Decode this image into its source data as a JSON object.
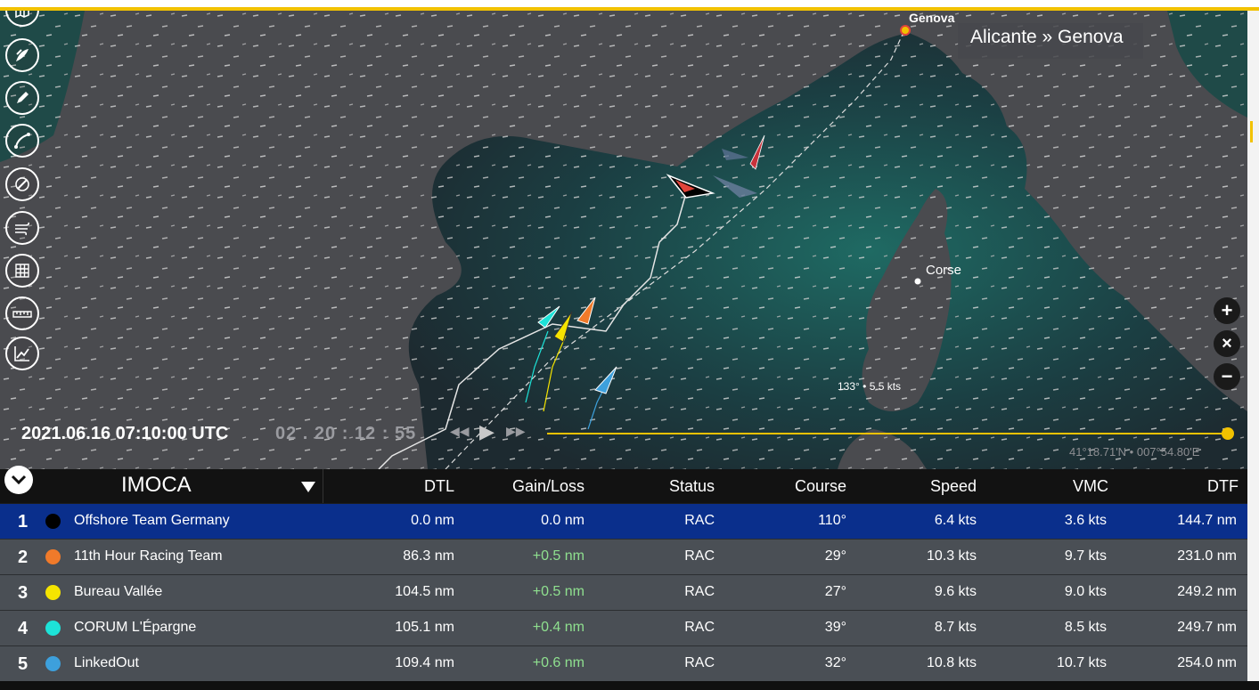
{
  "race": {
    "title": "Alicante » Genova"
  },
  "places": {
    "genova": "Genova",
    "corse": "Corse"
  },
  "wind_readout": "133° • 5.5 kts",
  "playback": {
    "datetime": "2021.06.16 07:10:00 UTC",
    "elapsed": "02 . 20 : 12 : 55",
    "rewind": "◀◀",
    "play": "▶",
    "forward": "▶▶",
    "progress_percent": 100
  },
  "coords": "41°18.71'N • 007°54.80'E",
  "zoom": {
    "in": "+",
    "reset": "×",
    "out": "−"
  },
  "tools": [
    "map-layers-icon",
    "sail-icon",
    "pencil-icon",
    "route-icon",
    "compass-icon",
    "wind-icon",
    "grid-icon",
    "ruler-icon",
    "chart-icon"
  ],
  "table": {
    "class_name": "IMOCA",
    "columns": {
      "dtl": "DTL",
      "gain": "Gain/Loss",
      "status": "Status",
      "course": "Course",
      "speed": "Speed",
      "vmc": "VMC",
      "dtf": "DTF"
    },
    "rows": [
      {
        "rank": "1",
        "color": "#000000",
        "name": "Offshore Team Germany",
        "dtl": "0.0 nm",
        "gain": "0.0 nm",
        "status": "RAC",
        "course": "110°",
        "speed": "6.4 kts",
        "vmc": "3.6 kts",
        "dtf": "144.7 nm"
      },
      {
        "rank": "2",
        "color": "#f07a2a",
        "name": "11th Hour Racing Team",
        "dtl": "86.3 nm",
        "gain": "+0.5 nm",
        "status": "RAC",
        "course": "29°",
        "speed": "10.3 kts",
        "vmc": "9.7 kts",
        "dtf": "231.0 nm"
      },
      {
        "rank": "3",
        "color": "#f5e400",
        "name": "Bureau Vallée",
        "dtl": "104.5 nm",
        "gain": "+0.5 nm",
        "status": "RAC",
        "course": "27°",
        "speed": "9.6 kts",
        "vmc": "9.0 kts",
        "dtf": "249.2 nm"
      },
      {
        "rank": "4",
        "color": "#1de3d8",
        "name": "CORUM L'Épargne",
        "dtl": "105.1 nm",
        "gain": "+0.4 nm",
        "status": "RAC",
        "course": "39°",
        "speed": "8.7 kts",
        "vmc": "8.5 kts",
        "dtf": "249.7 nm"
      },
      {
        "rank": "5",
        "color": "#3da0dc",
        "name": "LinkedOut",
        "dtl": "109.4 nm",
        "gain": "+0.6 nm",
        "status": "RAC",
        "course": "32°",
        "speed": "10.8 kts",
        "vmc": "10.7 kts",
        "dtf": "254.0 nm"
      }
    ]
  }
}
